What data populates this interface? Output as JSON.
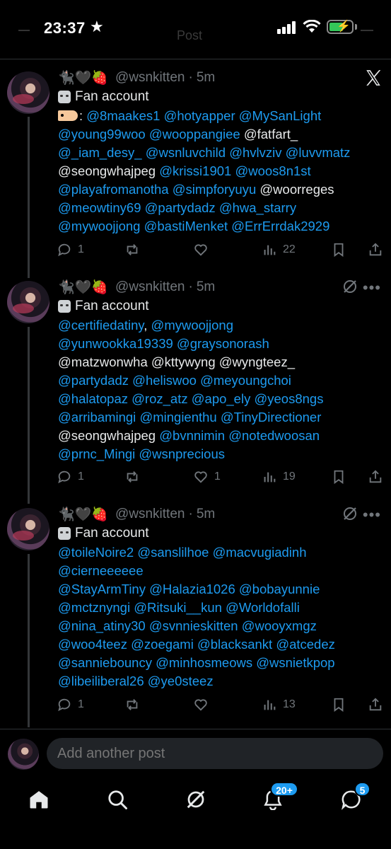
{
  "status_bar": {
    "time": "23:37",
    "star": "★",
    "faded_title": "Post"
  },
  "colors": {
    "mention": "#1d9bf0",
    "secondary": "#71767b",
    "background": "#000000",
    "badge": "#1d9bf0"
  },
  "posts": [
    {
      "name_emojis": "🐈‍⬛🖤🍓",
      "handle": "@wsnkitten",
      "separator": "·",
      "time": "5m",
      "bio": "Fan account",
      "corner_icon": "x-logo",
      "body_prefix": ":",
      "lines": [
        [
          {
            "t": "@8maakes1",
            "m": true
          },
          {
            "t": " ",
            "m": false
          },
          {
            "t": "@hotyapper",
            "m": true
          },
          {
            "t": " ",
            "m": false
          },
          {
            "t": "@MySanLight",
            "m": true
          }
        ],
        [
          {
            "t": "@young99woo",
            "m": true
          },
          {
            "t": " ",
            "m": false
          },
          {
            "t": "@wooppangiee",
            "m": true
          },
          {
            "t": " @fatfart_",
            "m": false
          }
        ],
        [
          {
            "t": "@_iam_desy_",
            "m": true
          },
          {
            "t": " ",
            "m": false
          },
          {
            "t": "@wsnluvchild",
            "m": true
          },
          {
            "t": " ",
            "m": false
          },
          {
            "t": "@hvlvziv",
            "m": true
          },
          {
            "t": " ",
            "m": false
          },
          {
            "t": "@luvvmatz",
            "m": true
          }
        ],
        [
          {
            "t": "@seongwhajpeg ",
            "m": false
          },
          {
            "t": "@krissi1901",
            "m": true
          },
          {
            "t": " ",
            "m": false
          },
          {
            "t": "@woos8n1st",
            "m": true
          }
        ],
        [
          {
            "t": "@playafromanotha",
            "m": true
          },
          {
            "t": " ",
            "m": false
          },
          {
            "t": "@simpforyuyu",
            "m": true
          },
          {
            "t": " @woorreges",
            "m": false
          }
        ],
        [
          {
            "t": "@meowtiny69",
            "m": true
          },
          {
            "t": " ",
            "m": false
          },
          {
            "t": "@partydadz",
            "m": true
          },
          {
            "t": " ",
            "m": false
          },
          {
            "t": "@hwa_starry",
            "m": true
          }
        ],
        [
          {
            "t": "@mywoojjong",
            "m": true
          },
          {
            "t": " ",
            "m": false
          },
          {
            "t": "@bastiMenket",
            "m": true
          },
          {
            "t": " ",
            "m": false
          },
          {
            "t": "@ErrErrdak2929",
            "m": true
          }
        ]
      ],
      "stats": {
        "replies": "1",
        "reposts": "",
        "likes": "",
        "views": "22"
      }
    },
    {
      "name_emojis": "🐈‍⬛🖤🍓",
      "handle": "@wsnkitten",
      "separator": "·",
      "time": "5m",
      "bio": "Fan account",
      "corner_icon": "grok-icon",
      "body_prefix": "",
      "lines": [
        [
          {
            "t": "@certifiedatiny",
            "m": true
          },
          {
            "t": ", ",
            "m": false
          },
          {
            "t": "@mywoojjong",
            "m": true
          }
        ],
        [
          {
            "t": "@yunwookka19339",
            "m": true
          },
          {
            "t": " ",
            "m": false
          },
          {
            "t": "@graysonorash",
            "m": true
          }
        ],
        [
          {
            "t": "@matzwonwha @kttywyng @wyngteez_",
            "m": false
          }
        ],
        [
          {
            "t": "@partydadz",
            "m": true
          },
          {
            "t": " ",
            "m": false
          },
          {
            "t": "@heliswoo",
            "m": true
          },
          {
            "t": " ",
            "m": false
          },
          {
            "t": "@meyoungchoi",
            "m": true
          }
        ],
        [
          {
            "t": "@halatopaz",
            "m": true
          },
          {
            "t": " ",
            "m": false
          },
          {
            "t": "@roz_atz",
            "m": true
          },
          {
            "t": " ",
            "m": false
          },
          {
            "t": "@apo_ely",
            "m": true
          },
          {
            "t": " ",
            "m": false
          },
          {
            "t": "@yeos8ngs",
            "m": true
          }
        ],
        [
          {
            "t": "@arribamingi",
            "m": true
          },
          {
            "t": " ",
            "m": false
          },
          {
            "t": "@mingienthu",
            "m": true
          },
          {
            "t": " ",
            "m": false
          },
          {
            "t": "@TinyDirectioner",
            "m": true
          }
        ],
        [
          {
            "t": "@seongwhajpeg ",
            "m": false
          },
          {
            "t": "@bvnnimin",
            "m": true
          },
          {
            "t": " ",
            "m": false
          },
          {
            "t": "@notedwoosan",
            "m": true
          }
        ],
        [
          {
            "t": "@prnc_Mingi",
            "m": true
          },
          {
            "t": " ",
            "m": false
          },
          {
            "t": "@wsnprecious",
            "m": true
          }
        ]
      ],
      "stats": {
        "replies": "1",
        "reposts": "",
        "likes": "1",
        "views": "19"
      }
    },
    {
      "name_emojis": "🐈‍⬛🖤🍓",
      "handle": "@wsnkitten",
      "separator": "·",
      "time": "5m",
      "bio": "Fan account",
      "corner_icon": "grok-icon",
      "body_prefix": "",
      "lines": [
        [
          {
            "t": "@toileNoire2",
            "m": true
          },
          {
            "t": " ",
            "m": false
          },
          {
            "t": "@sanslilhoe",
            "m": true
          },
          {
            "t": " ",
            "m": false
          },
          {
            "t": "@macvugiadinh",
            "m": true
          }
        ],
        [
          {
            "t": "@cierneeeeee",
            "m": true
          }
        ],
        [
          {
            "t": "@StayArmTiny",
            "m": true
          },
          {
            "t": " ",
            "m": false
          },
          {
            "t": "@Halazia1026",
            "m": true
          },
          {
            "t": " ",
            "m": false
          },
          {
            "t": "@bobayunnie",
            "m": true
          }
        ],
        [
          {
            "t": "@mctznyngi",
            "m": true
          },
          {
            "t": " ",
            "m": false
          },
          {
            "t": "@Ritsuki__kun",
            "m": true
          },
          {
            "t": " ",
            "m": false
          },
          {
            "t": "@Worldofalli",
            "m": true
          }
        ],
        [
          {
            "t": "@nina_atiny30",
            "m": true
          },
          {
            "t": " ",
            "m": false
          },
          {
            "t": "@svnnieskitten",
            "m": true
          },
          {
            "t": " ",
            "m": false
          },
          {
            "t": "@wooyxmgz",
            "m": true
          }
        ],
        [
          {
            "t": "@woo4teez",
            "m": true
          },
          {
            "t": " ",
            "m": false
          },
          {
            "t": "@zoegami",
            "m": true
          },
          {
            "t": " ",
            "m": false
          },
          {
            "t": "@blacksankt",
            "m": true
          },
          {
            "t": " ",
            "m": false
          },
          {
            "t": "@atcedez",
            "m": true
          }
        ],
        [
          {
            "t": "@sanniebouncy",
            "m": true
          },
          {
            "t": " ",
            "m": false
          },
          {
            "t": "@minhosmeows",
            "m": true
          },
          {
            "t": " ",
            "m": false
          },
          {
            "t": "@wsnietkpop",
            "m": true
          }
        ],
        [
          {
            "t": "@libeiliberal26",
            "m": true
          },
          {
            "t": " ",
            "m": false
          },
          {
            "t": "@ye0steez",
            "m": true
          }
        ]
      ],
      "stats": {
        "replies": "1",
        "reposts": "",
        "likes": "",
        "views": "13"
      }
    }
  ],
  "reply": {
    "placeholder": "Add another post"
  },
  "nav": {
    "items": [
      "home-icon",
      "search-icon",
      "grok-icon",
      "notifications-icon",
      "messages-icon"
    ],
    "notifications_badge": "20+",
    "messages_badge": "5"
  }
}
